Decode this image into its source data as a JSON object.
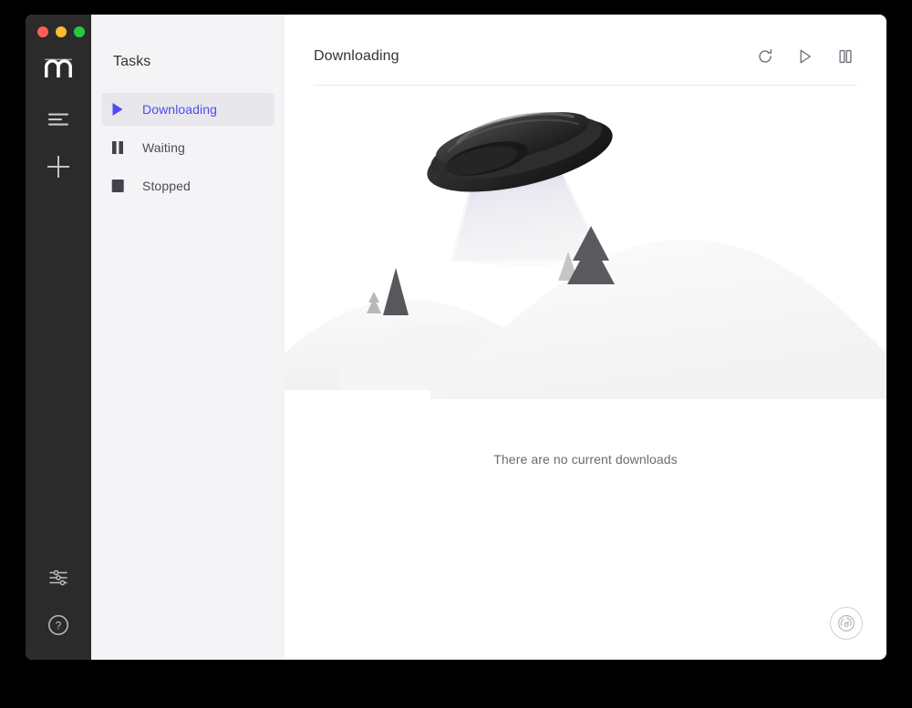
{
  "window": {
    "traffic_lights": [
      {
        "name": "close",
        "color": "#ff5f57"
      },
      {
        "name": "minimize",
        "color": "#ffbd2e"
      },
      {
        "name": "maximize",
        "color": "#28c840"
      }
    ],
    "rail": {
      "logo_name": "motrix-logo",
      "items": [
        {
          "name": "menu-icon",
          "label": "Menu"
        },
        {
          "name": "plus-icon",
          "label": "Add Task"
        }
      ],
      "bottom_items": [
        {
          "name": "preferences-icon",
          "label": "Preferences"
        },
        {
          "name": "help-icon",
          "label": "Help"
        }
      ]
    }
  },
  "sidebar": {
    "title": "Tasks",
    "items": [
      {
        "label": "Downloading",
        "icon": "play-icon",
        "active": true
      },
      {
        "label": "Waiting",
        "icon": "pause-icon",
        "active": false
      },
      {
        "label": "Stopped",
        "icon": "stop-icon",
        "active": false
      }
    ]
  },
  "main": {
    "title": "Downloading",
    "actions": [
      {
        "name": "refresh-button",
        "label": "Refresh",
        "icon": "refresh-icon"
      },
      {
        "name": "resume-all-button",
        "label": "Resume All",
        "icon": "play-icon"
      },
      {
        "name": "pause-all-button",
        "label": "Pause All",
        "icon": "pause-icon"
      }
    ],
    "empty_state": {
      "message": "There are no current downloads",
      "illustration": "ufo-beam-hills-trees"
    },
    "speed_button": {
      "name": "speedometer-button",
      "label": "Speed"
    }
  },
  "colors": {
    "accent": "#4d4df0",
    "rail_background": "#2b2b2b",
    "sidebar_background": "#f4f4f6",
    "panel_background": "#ffffff",
    "active_item_background": "#e7e7ec",
    "text_primary": "#333333",
    "text_secondary": "#6a6a72"
  }
}
